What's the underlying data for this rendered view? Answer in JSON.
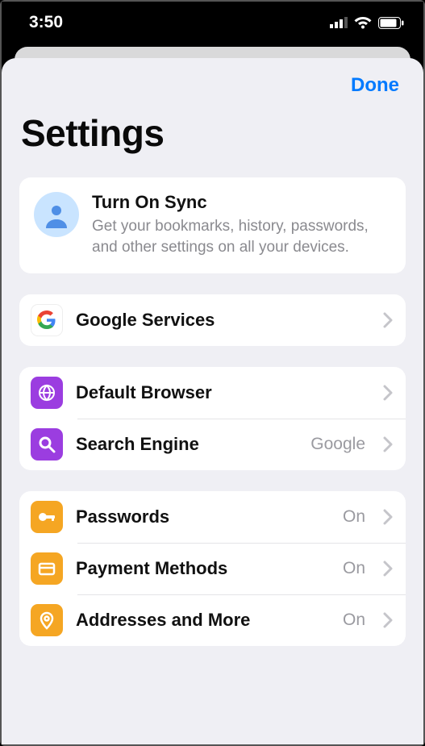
{
  "status": {
    "time": "3:50"
  },
  "nav": {
    "done": "Done"
  },
  "title": "Settings",
  "sync": {
    "title": "Turn On Sync",
    "subtitle": "Get your bookmarks, history, passwords, and other settings on all your devices."
  },
  "rows": {
    "google_services": {
      "label": "Google Services"
    },
    "default_browser": {
      "label": "Default Browser"
    },
    "search_engine": {
      "label": "Search Engine",
      "value": "Google"
    },
    "passwords": {
      "label": "Passwords",
      "value": "On"
    },
    "payment": {
      "label": "Payment Methods",
      "value": "On"
    },
    "addresses": {
      "label": "Addresses and More",
      "value": "On"
    }
  }
}
